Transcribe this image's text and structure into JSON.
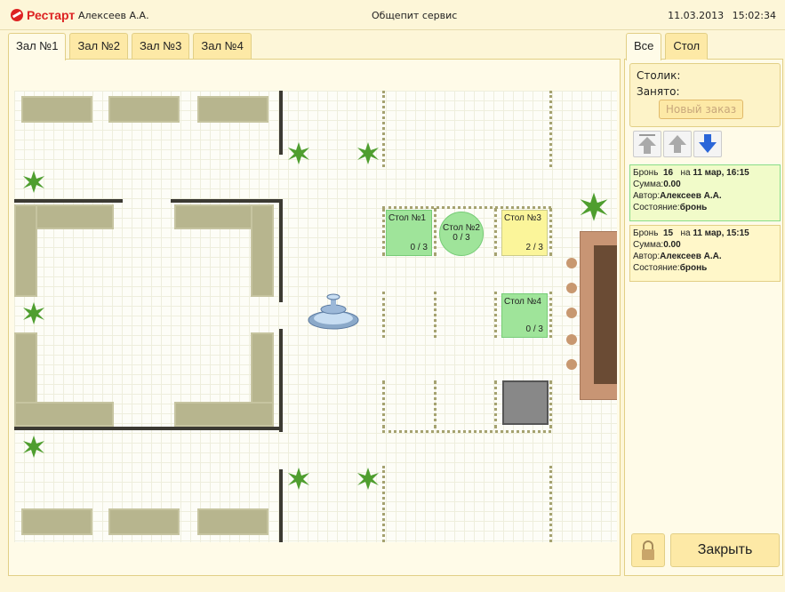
{
  "header": {
    "brand": "Рестарт",
    "user": "Алексеев А.А.",
    "app": "Общепит сервис",
    "date": "11.03.2013",
    "time": "15:02:34"
  },
  "halls": [
    {
      "label": "Зал №1"
    },
    {
      "label": "Зал №2"
    },
    {
      "label": "Зал №3"
    },
    {
      "label": "Зал №4"
    }
  ],
  "tables": [
    {
      "name": "Стол №1",
      "count": "0 / 3",
      "status": "free"
    },
    {
      "name": "Стол №2",
      "count": "0 / 3",
      "status": "free"
    },
    {
      "name": "Стол №3",
      "count": "2 / 3",
      "status": "busy"
    },
    {
      "name": "Стол №4",
      "count": "0 / 3",
      "status": "free"
    }
  ],
  "right_tabs": [
    {
      "label": "Все"
    },
    {
      "label": "Стол"
    }
  ],
  "table_info": {
    "table_label": "Столик:",
    "occupied_label": "Занято:",
    "new_order": "Новый заказ"
  },
  "reservations": [
    {
      "prefix": "Бронь",
      "num": "16",
      "on": "на",
      "when": "11 мар, 16:15",
      "sum_label": "Сумма:",
      "sum": "0.00",
      "author_label": "Автор:",
      "author": "Алексеев А.А.",
      "state_label": "Состояние:",
      "state": "бронь"
    },
    {
      "prefix": "Бронь",
      "num": "15",
      "on": "на",
      "when": "11 мар, 15:15",
      "sum_label": "Сумма:",
      "sum": "0.00",
      "author_label": "Автор:",
      "author": "Алексеев А.А.",
      "state_label": "Состояние:",
      "state": "бронь"
    }
  ],
  "close_label": "Закрыть",
  "colors": {
    "accent": "#dd2222",
    "free": "#9fe49a",
    "busy": "#fbf59a"
  }
}
